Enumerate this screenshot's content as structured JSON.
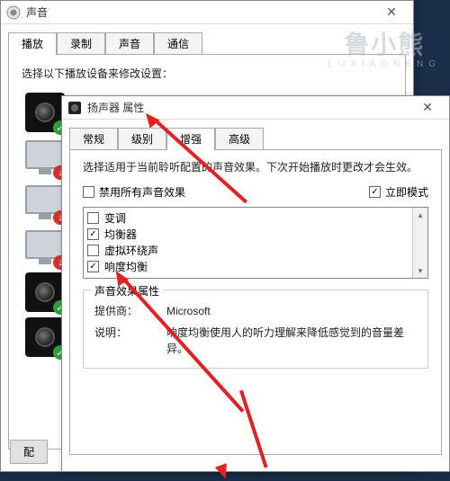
{
  "watermark": {
    "zh": "鲁小熊",
    "en": "LUXIAONENG"
  },
  "sound_window": {
    "title": "声音",
    "tabs": [
      "播放",
      "录制",
      "声音",
      "通信"
    ],
    "active_tab": 0,
    "hint": "选择以下播放设备来修改设置：",
    "devices": [
      {
        "kind": "speaker",
        "badge": "ok"
      },
      {
        "kind": "monitor",
        "badge": "down"
      },
      {
        "kind": "monitor",
        "badge": "down"
      },
      {
        "kind": "monitor",
        "badge": "down"
      },
      {
        "kind": "speaker",
        "badge": "ok"
      },
      {
        "kind": "speaker",
        "badge": "ok"
      }
    ],
    "configure_btn": "配"
  },
  "props_window": {
    "title": "扬声器 属性",
    "tabs": [
      "常规",
      "级别",
      "增强",
      "高级"
    ],
    "active_tab": 2,
    "desc": "选择适用于当前聆听配置的声音效果。下次开始播放时更改才会生效。",
    "disable_all": {
      "label": "禁用所有声音效果",
      "checked": false
    },
    "immediate": {
      "label": "立即模式",
      "checked": true
    },
    "effects": [
      {
        "label": "变调",
        "checked": false
      },
      {
        "label": "均衡器",
        "checked": true
      },
      {
        "label": "虚拟环绕声",
        "checked": false
      },
      {
        "label": "响度均衡",
        "checked": true
      }
    ],
    "fieldset_legend": "声音效果属性",
    "provider_k": "提供商：",
    "provider_v": "Microsoft",
    "desc_k": "说明：",
    "desc_v": "响度均衡使用人的听力理解来降低感觉到的音量差异。"
  }
}
